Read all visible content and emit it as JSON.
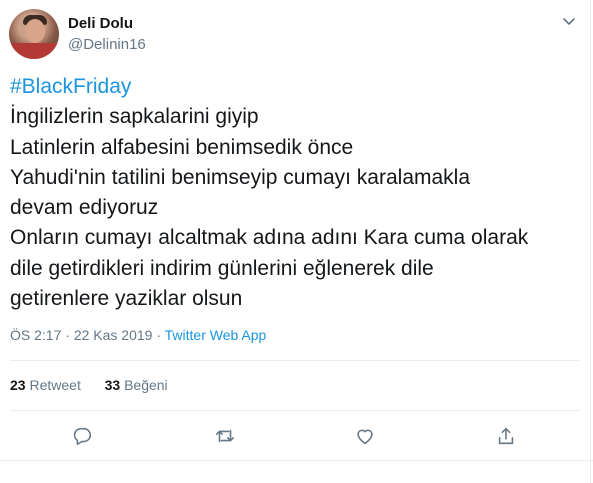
{
  "user": {
    "display_name": "Deli Dolu",
    "handle": "@Delinin16"
  },
  "tweet": {
    "hashtag": "#BlackFriday",
    "lines": [
      "İngilizlerin sapkalarini giyip",
      "Latinlerin alfabesini benimsedik önce",
      "Yahudi'nin tatilini benimseyip cumayı karalamakla",
      "devam ediyoruz",
      "Onların cumayı alcaltmak adına adını Kara cuma olarak",
      "dile getirdikleri indirim günlerini eğlenerek dile",
      "getirenlere yaziklar olsun"
    ]
  },
  "meta": {
    "time": "ÖS 2:17",
    "separator1": " · ",
    "date": "22 Kas 2019",
    "separator2": " · ",
    "source": "Twitter Web App"
  },
  "stats": {
    "retweet_count": "23",
    "retweet_label": "Retweet",
    "like_count": "33",
    "like_label": "Beğeni"
  },
  "icons": {
    "menu": "chevron-down-icon",
    "reply": "reply-icon",
    "retweet": "retweet-icon",
    "like": "heart-icon",
    "share": "share-icon"
  },
  "colors": {
    "link": "#1b95e0",
    "secondary_text": "#657786",
    "primary_text": "#14171a",
    "border": "#e6ecf0"
  }
}
